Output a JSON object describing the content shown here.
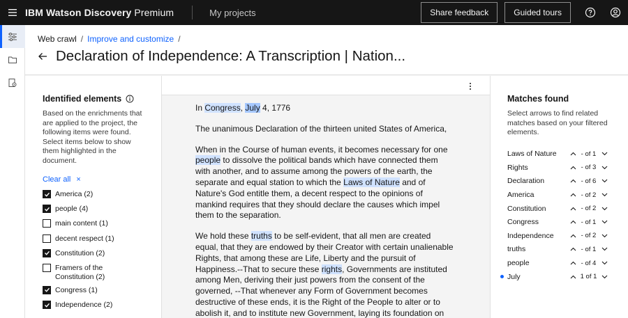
{
  "header": {
    "brand_bold": "IBM Watson Discovery",
    "brand_light": "Premium",
    "nav_projects": "My projects",
    "share_feedback": "Share feedback",
    "guided_tours": "Guided tours",
    "help_icon": "help-icon",
    "user_icon": "user-avatar-icon"
  },
  "rail": {
    "items": [
      {
        "icon": "sliders-icon",
        "active": true
      },
      {
        "icon": "folder-icon",
        "active": false
      },
      {
        "icon": "document-settings-icon",
        "active": false
      }
    ]
  },
  "breadcrumb": {
    "item1": "Web crawl",
    "sep1": "/",
    "item2": "Improve and customize",
    "sep2": "/"
  },
  "page": {
    "title": "Declaration of Independence: A Transcription | Nation..."
  },
  "identified": {
    "heading": "Identified elements",
    "description": "Based on the enrichments that are applied to the project, the following items were found. Select items below to show them highlighted in the document.",
    "clear_all": "Clear all",
    "clear_icon": "×",
    "items": [
      {
        "label": "America (2)",
        "checked": true
      },
      {
        "label": "people (4)",
        "checked": true
      },
      {
        "label": "main content (1)",
        "checked": false
      },
      {
        "label": "decent respect (1)",
        "checked": false
      },
      {
        "label": "Constitution (2)",
        "checked": true
      },
      {
        "label": "Framers of the Constitution (2)",
        "checked": false
      },
      {
        "label": "Congress (1)",
        "checked": true
      },
      {
        "label": "Independence (2)",
        "checked": true
      }
    ]
  },
  "document": {
    "p1": {
      "a": "In ",
      "b": "Congress",
      "c": ", ",
      "d": "July",
      "e": " 4, 1776"
    },
    "p2": "The unanimous Declaration of the thirteen united States of America,",
    "p3": {
      "a": "When in the Course of human events, it becomes necessary for one ",
      "b": "people",
      "c": " to dissolve the political bands which have connected them with another, and to assume among the powers of the earth, the separate and equal station to which the ",
      "d": "Laws of Nature",
      "e": " and of Nature's God entitle them, a decent respect to the opinions of mankind requires that they should declare the causes which impel them to the separation."
    },
    "p4": {
      "a": "We hold these ",
      "b": "truths",
      "c": " to be self-evident, that all men are created equal, that they are endowed by their Creator with certain unalienable Rights, that among these are Life, Liberty and the pursuit of Happiness.--That to secure these ",
      "d": "rights",
      "e": ", Governments are instituted among Men, deriving their just powers from the consent of the governed, --That whenever any Form of Government becomes destructive of these ends, it is the Right of the People to alter or to abolish it, and to institute new Government, laying its foundation on"
    }
  },
  "matches": {
    "heading": "Matches found",
    "description": "Select arrows to find related matches based on your filtered elements.",
    "items": [
      {
        "name": "Laws of Nature",
        "count": "- of 1",
        "current": false
      },
      {
        "name": "Rights",
        "count": "- of 3",
        "current": false
      },
      {
        "name": "Declaration",
        "count": "- of 6",
        "current": false
      },
      {
        "name": "America",
        "count": "- of 2",
        "current": false
      },
      {
        "name": "Constitution",
        "count": "- of 2",
        "current": false
      },
      {
        "name": "Congress",
        "count": "- of 1",
        "current": false
      },
      {
        "name": "Independence",
        "count": "- of 2",
        "current": false
      },
      {
        "name": "truths",
        "count": "- of 1",
        "current": false
      },
      {
        "name": "people",
        "count": "- of 4",
        "current": false
      },
      {
        "name": "July",
        "count": "1 of 1",
        "current": true
      }
    ]
  },
  "colors": {
    "accent": "#0f62fe",
    "highlight": "#d0e2ff",
    "highlight_active": "#a6c8ff",
    "header_bg": "#161616"
  }
}
